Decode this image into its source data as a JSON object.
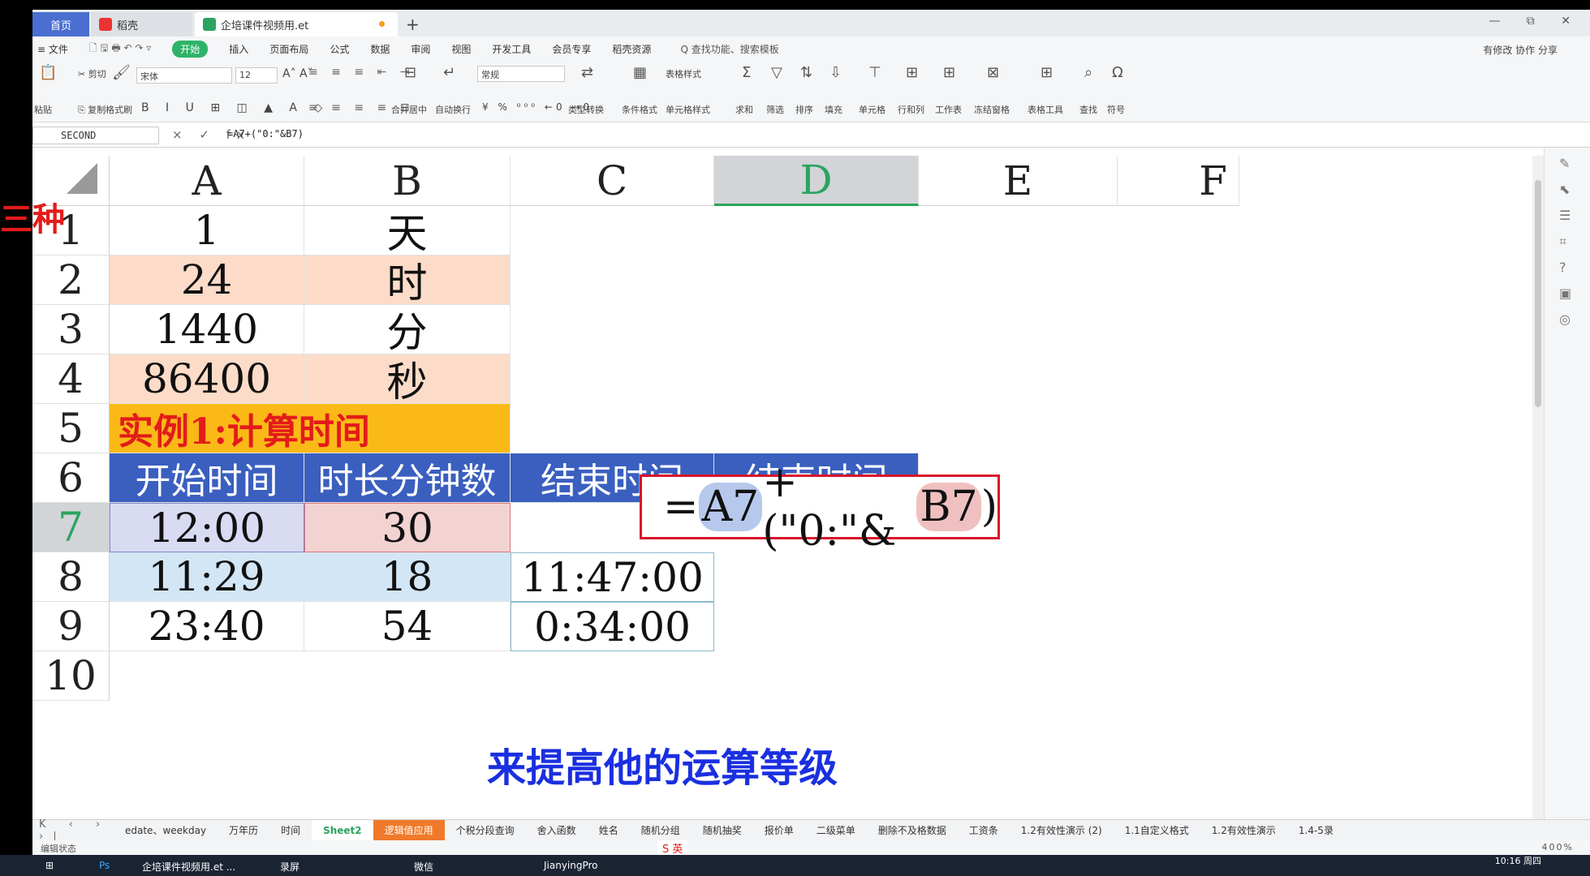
{
  "titlebar": {
    "tabs": [
      {
        "label": "首页"
      },
      {
        "label": "稻壳"
      },
      {
        "label": "企培课件视频用.et"
      }
    ],
    "add_label": "+",
    "window_controls": "— ⧉ ✕"
  },
  "menubar": {
    "file_label": "≡ 文件",
    "items": [
      "开始",
      "插入",
      "页面布局",
      "公式",
      "数据",
      "审阅",
      "视图",
      "开发工具",
      "会员专享",
      "稻壳资源"
    ],
    "search_placeholder": "Q 查找功能、搜索模板",
    "right_label": "有修改  协作  分享"
  },
  "ribbon": {
    "paste": "粘贴",
    "cut": "剪切",
    "copy": "复制",
    "format_painter": "格式刷",
    "font_name": "宋体",
    "font_size": "12",
    "number_format": "常规",
    "merge_center": "合并居中",
    "auto_wrap": "自动换行",
    "type_convert": "类型转换",
    "conditional_format": "条件格式",
    "table_style": "表格样式",
    "cell_style": "单元格样式",
    "sum": "求和",
    "filter": "筛选",
    "sort": "排序",
    "fill": "填充",
    "cell": "单元格",
    "row_col": "行和列",
    "worksheet": "工作表",
    "freeze": "冻结窗格",
    "table_tools": "表格工具",
    "find": "查找",
    "symbol": "符号"
  },
  "formulabar": {
    "name_box": "SECOND",
    "formula": "=A7+(\"0:\"&B7)",
    "icons": "× ✓ fx"
  },
  "grid": {
    "columns": [
      "A",
      "B",
      "C",
      "D",
      "E",
      "F"
    ],
    "rows": [
      "1",
      "2",
      "3",
      "4",
      "5",
      "6",
      "7",
      "8",
      "9",
      "10"
    ],
    "cells": {
      "A1": "1",
      "B1": "天",
      "A2": "24",
      "B2": "时",
      "A3": "1440",
      "B3": "分",
      "A4": "86400",
      "B4": "秒",
      "A5": "实例1:计算时间",
      "A6": "开始时间",
      "B6": "时长分钟数",
      "C6": "结束时间",
      "D6": "结束时间",
      "A7": "12:00",
      "B7": "30",
      "A8": "11:29",
      "B8": "18",
      "C8": "11:47:00",
      "A9": "23:40",
      "B9": "54",
      "C9": "0:34:00"
    },
    "overlay": {
      "eq": "=",
      "ref_a": "A7",
      "op": "+(\"0:\"&",
      "ref_b": "B7",
      "close": ")"
    }
  },
  "overlays": {
    "left_label": "三种",
    "subtitle": "来提高他的运算等级"
  },
  "sheets": [
    "edate、weekday",
    "万年历",
    "时间",
    "Sheet2",
    "逻辑值应用",
    "个税分段查询",
    "舍入函数",
    "姓名",
    "随机分组",
    "随机抽奖",
    "报价单",
    "二级菜单",
    "删除不及格数据",
    "工资条",
    "1.2有效性演示 (2)",
    "1.1自定义格式",
    "1.2有效性演示",
    "1.4-5录"
  ],
  "active_sheet": "Sheet2",
  "statusbar": {
    "left": "编辑状态",
    "ime": "S 英",
    "zoom": "400%"
  },
  "taskbar": {
    "items": [
      "企培课件视频用.et ...",
      "录屏",
      "微信",
      "JianyingPro"
    ],
    "time": "10:16 周四"
  },
  "colors": {
    "accent_green": "#2aa460",
    "peach": "#fcdcc8",
    "orange": "#fbb917",
    "header_blue": "#3a5fbf",
    "highlight_red": "#d9142a"
  }
}
